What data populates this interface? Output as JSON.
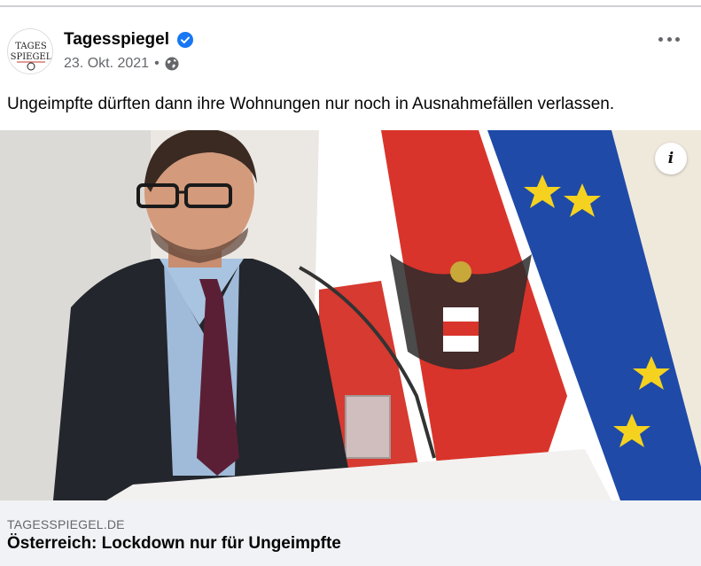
{
  "post": {
    "page_name": "Tagesspiegel",
    "date": "23. Okt. 2021",
    "separator": "•",
    "text": "Ungeimpfte dürften dann ihre Wohnungen nur noch in Ausnahmefällen verlassen.",
    "avatar_logo_text": [
      "TAGES",
      "SPIEGEL"
    ]
  },
  "icons": {
    "verified": "verified-badge-icon",
    "privacy": "globe-icon",
    "menu": "more-options-icon",
    "info": "info-icon"
  },
  "info_glyph": "i",
  "link_preview": {
    "domain": "TAGESSPIEGEL.DE",
    "title": "Österreich: Lockdown nur für Ungeimpfte"
  },
  "colors": {
    "accent": "#1877f2",
    "secondary_text": "#65676b",
    "preview_bg": "#f0f2f5",
    "austria_red": "#d9342b",
    "eu_blue": "#1f4aa8",
    "eu_star": "#f4d21f"
  }
}
